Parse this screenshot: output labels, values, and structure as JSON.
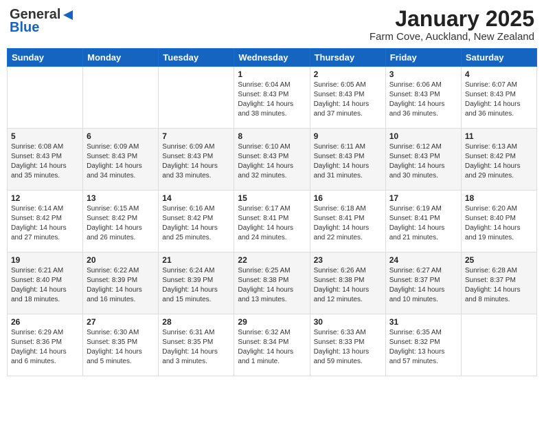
{
  "logo": {
    "line1": "General",
    "line2": "Blue"
  },
  "title": "January 2025",
  "subtitle": "Farm Cove, Auckland, New Zealand",
  "weekdays": [
    "Sunday",
    "Monday",
    "Tuesday",
    "Wednesday",
    "Thursday",
    "Friday",
    "Saturday"
  ],
  "weeks": [
    [
      {
        "day": "",
        "info": ""
      },
      {
        "day": "",
        "info": ""
      },
      {
        "day": "",
        "info": ""
      },
      {
        "day": "1",
        "info": "Sunrise: 6:04 AM\nSunset: 8:43 PM\nDaylight: 14 hours\nand 38 minutes."
      },
      {
        "day": "2",
        "info": "Sunrise: 6:05 AM\nSunset: 8:43 PM\nDaylight: 14 hours\nand 37 minutes."
      },
      {
        "day": "3",
        "info": "Sunrise: 6:06 AM\nSunset: 8:43 PM\nDaylight: 14 hours\nand 36 minutes."
      },
      {
        "day": "4",
        "info": "Sunrise: 6:07 AM\nSunset: 8:43 PM\nDaylight: 14 hours\nand 36 minutes."
      }
    ],
    [
      {
        "day": "5",
        "info": "Sunrise: 6:08 AM\nSunset: 8:43 PM\nDaylight: 14 hours\nand 35 minutes."
      },
      {
        "day": "6",
        "info": "Sunrise: 6:09 AM\nSunset: 8:43 PM\nDaylight: 14 hours\nand 34 minutes."
      },
      {
        "day": "7",
        "info": "Sunrise: 6:09 AM\nSunset: 8:43 PM\nDaylight: 14 hours\nand 33 minutes."
      },
      {
        "day": "8",
        "info": "Sunrise: 6:10 AM\nSunset: 8:43 PM\nDaylight: 14 hours\nand 32 minutes."
      },
      {
        "day": "9",
        "info": "Sunrise: 6:11 AM\nSunset: 8:43 PM\nDaylight: 14 hours\nand 31 minutes."
      },
      {
        "day": "10",
        "info": "Sunrise: 6:12 AM\nSunset: 8:43 PM\nDaylight: 14 hours\nand 30 minutes."
      },
      {
        "day": "11",
        "info": "Sunrise: 6:13 AM\nSunset: 8:42 PM\nDaylight: 14 hours\nand 29 minutes."
      }
    ],
    [
      {
        "day": "12",
        "info": "Sunrise: 6:14 AM\nSunset: 8:42 PM\nDaylight: 14 hours\nand 27 minutes."
      },
      {
        "day": "13",
        "info": "Sunrise: 6:15 AM\nSunset: 8:42 PM\nDaylight: 14 hours\nand 26 minutes."
      },
      {
        "day": "14",
        "info": "Sunrise: 6:16 AM\nSunset: 8:42 PM\nDaylight: 14 hours\nand 25 minutes."
      },
      {
        "day": "15",
        "info": "Sunrise: 6:17 AM\nSunset: 8:41 PM\nDaylight: 14 hours\nand 24 minutes."
      },
      {
        "day": "16",
        "info": "Sunrise: 6:18 AM\nSunset: 8:41 PM\nDaylight: 14 hours\nand 22 minutes."
      },
      {
        "day": "17",
        "info": "Sunrise: 6:19 AM\nSunset: 8:41 PM\nDaylight: 14 hours\nand 21 minutes."
      },
      {
        "day": "18",
        "info": "Sunrise: 6:20 AM\nSunset: 8:40 PM\nDaylight: 14 hours\nand 19 minutes."
      }
    ],
    [
      {
        "day": "19",
        "info": "Sunrise: 6:21 AM\nSunset: 8:40 PM\nDaylight: 14 hours\nand 18 minutes."
      },
      {
        "day": "20",
        "info": "Sunrise: 6:22 AM\nSunset: 8:39 PM\nDaylight: 14 hours\nand 16 minutes."
      },
      {
        "day": "21",
        "info": "Sunrise: 6:24 AM\nSunset: 8:39 PM\nDaylight: 14 hours\nand 15 minutes."
      },
      {
        "day": "22",
        "info": "Sunrise: 6:25 AM\nSunset: 8:38 PM\nDaylight: 14 hours\nand 13 minutes."
      },
      {
        "day": "23",
        "info": "Sunrise: 6:26 AM\nSunset: 8:38 PM\nDaylight: 14 hours\nand 12 minutes."
      },
      {
        "day": "24",
        "info": "Sunrise: 6:27 AM\nSunset: 8:37 PM\nDaylight: 14 hours\nand 10 minutes."
      },
      {
        "day": "25",
        "info": "Sunrise: 6:28 AM\nSunset: 8:37 PM\nDaylight: 14 hours\nand 8 minutes."
      }
    ],
    [
      {
        "day": "26",
        "info": "Sunrise: 6:29 AM\nSunset: 8:36 PM\nDaylight: 14 hours\nand 6 minutes."
      },
      {
        "day": "27",
        "info": "Sunrise: 6:30 AM\nSunset: 8:35 PM\nDaylight: 14 hours\nand 5 minutes."
      },
      {
        "day": "28",
        "info": "Sunrise: 6:31 AM\nSunset: 8:35 PM\nDaylight: 14 hours\nand 3 minutes."
      },
      {
        "day": "29",
        "info": "Sunrise: 6:32 AM\nSunset: 8:34 PM\nDaylight: 14 hours\nand 1 minute."
      },
      {
        "day": "30",
        "info": "Sunrise: 6:33 AM\nSunset: 8:33 PM\nDaylight: 13 hours\nand 59 minutes."
      },
      {
        "day": "31",
        "info": "Sunrise: 6:35 AM\nSunset: 8:32 PM\nDaylight: 13 hours\nand 57 minutes."
      },
      {
        "day": "",
        "info": ""
      }
    ]
  ]
}
